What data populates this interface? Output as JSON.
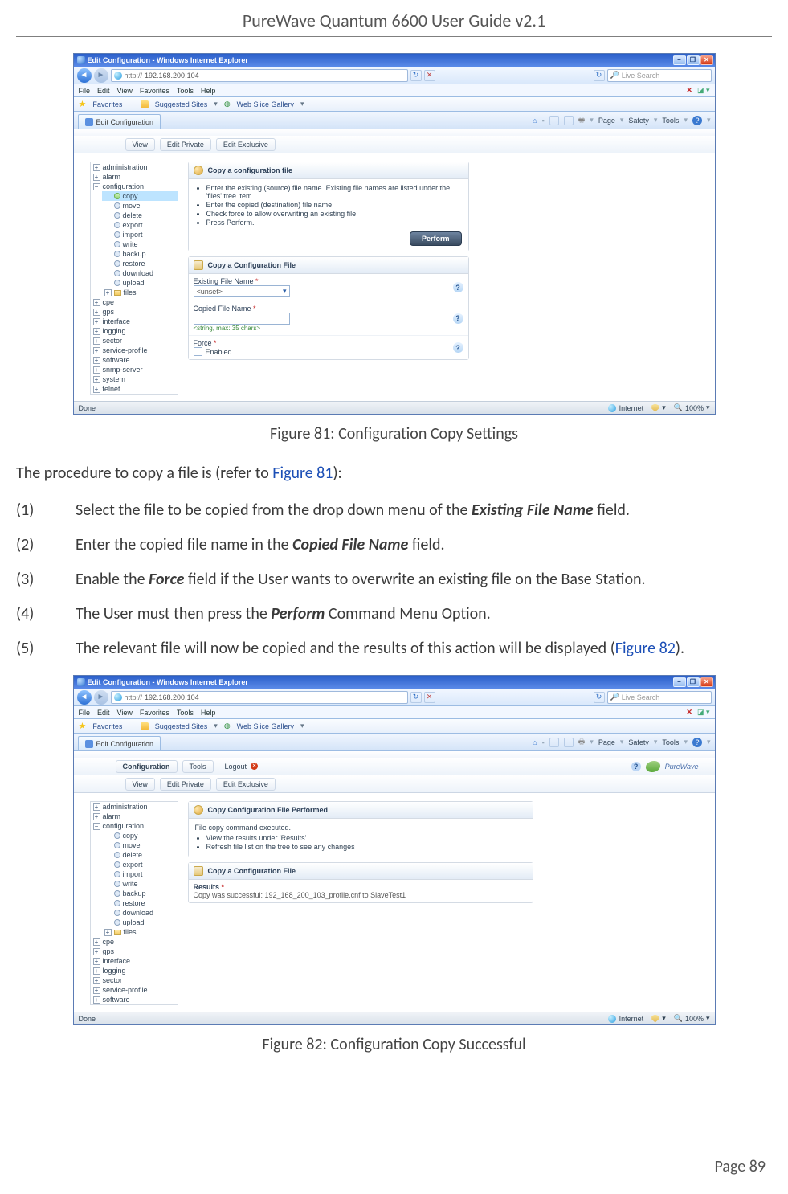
{
  "doc": {
    "header": "PureWave Quantum 6600 User Guide v2.1",
    "fig81_caption": "Figure 81: Configuration Copy Settings",
    "fig82_caption": "Figure 82: Configuration Copy Successful",
    "intro_pre": "The procedure to copy a file is (refer to ",
    "intro_link": "Figure 81",
    "intro_post": "):",
    "steps": [
      {
        "n": "(1)",
        "pre": "Select the file to be copied from the drop down menu of the ",
        "b": "Existing File Name",
        "post": " field."
      },
      {
        "n": "(2)",
        "pre": "Enter the copied file name in the ",
        "b": "Copied File Name",
        "post": " field."
      },
      {
        "n": "(3)",
        "pre": "Enable the ",
        "b": "Force",
        "post": " field if the User wants to overwrite an existing file on the Base Station."
      },
      {
        "n": "(4)",
        "pre": "The User must then press the ",
        "b": "Perform",
        "post": " Command Menu Option."
      },
      {
        "n": "(5)",
        "pre": "The relevant file will now be copied and the results of this action will be displayed (",
        "link": "Figure 82",
        "post2": ")."
      }
    ],
    "page_label": "Page 89"
  },
  "ie": {
    "title": "Edit Configuration - Windows Internet Explorer",
    "url1": "192.168.200.104",
    "url2": "192.168.200.104",
    "search_placeholder": "Live Search",
    "menu": [
      "File",
      "Edit",
      "View",
      "Favorites",
      "Tools",
      "Help"
    ],
    "fav_label": "Favorites",
    "suggested": "Suggested Sites",
    "slice": "Web Slice Gallery",
    "tab_label": "Edit Configuration",
    "tools": {
      "page": "Page",
      "safety": "Safety",
      "tools": "Tools"
    },
    "status_done": "Done",
    "status_internet": "Internet",
    "zoom": "100%"
  },
  "app": {
    "tabs": {
      "config": "Configuration",
      "tools": "Tools",
      "logout": "Logout"
    },
    "subtabs": [
      "View",
      "Edit Private",
      "Edit Exclusive"
    ],
    "logo": "PureWave",
    "tree_top": [
      "administration",
      "alarm"
    ],
    "tree_cfg": "configuration",
    "tree_cfg_children": [
      "copy",
      "move",
      "delete",
      "export",
      "import",
      "write",
      "backup",
      "restore",
      "download",
      "upload"
    ],
    "tree_files": "files",
    "tree_rest": [
      "cpe",
      "gps",
      "interface",
      "logging",
      "sector",
      "service-profile",
      "software",
      "snmp-server",
      "system",
      "telnet"
    ],
    "tree_rest2": [
      "cpe",
      "gps",
      "interface",
      "logging",
      "sector",
      "service-profile",
      "software"
    ]
  },
  "panel1": {
    "hd1": "Copy a configuration file",
    "tips": [
      "Enter the existing (source) file name. Existing file names are listed under the 'files' tree item.",
      "Enter the copied (destination) file name",
      "Check force to allow overwriting an existing file",
      "Press Perform."
    ],
    "perform": "Perform",
    "hd2": "Copy a Configuration File",
    "existing_label": "Existing File Name",
    "existing_value": "<unset>",
    "copied_label": "Copied File Name",
    "copied_hint": "<string, max: 35 chars>",
    "force_label": "Force",
    "force_value": "Enabled"
  },
  "panel2": {
    "hd1": "Copy Configuration File Performed",
    "exec": "File copy command executed.",
    "tips": [
      "View the results under 'Results'",
      "Refresh file list on the tree to see any changes"
    ],
    "hd2": "Copy a Configuration File",
    "results_label": "Results",
    "results_value": "Copy was successful: 192_168_200_103_profile.cnf to SlaveTest1"
  }
}
